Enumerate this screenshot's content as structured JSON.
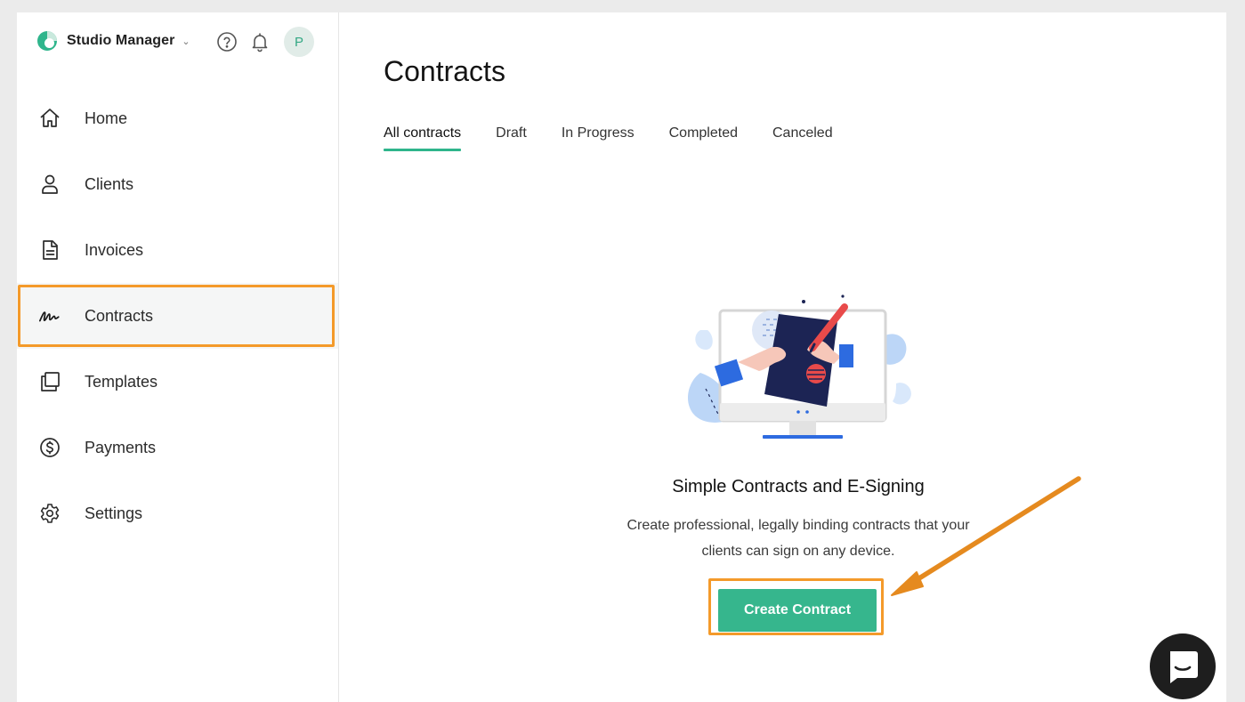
{
  "sidebar": {
    "brand": {
      "name": "Studio Manager",
      "chevron": "⌄",
      "logo_icon": "studio-logo-icon"
    },
    "top_icons": {
      "help": "help-circle-icon",
      "notifications": "bell-icon"
    },
    "avatar_initial": "P",
    "items": [
      {
        "label": "Home",
        "icon": "home-icon",
        "active": false
      },
      {
        "label": "Clients",
        "icon": "user-icon",
        "active": false
      },
      {
        "label": "Invoices",
        "icon": "document-icon",
        "active": false
      },
      {
        "label": "Contracts",
        "icon": "signature-icon",
        "active": true
      },
      {
        "label": "Templates",
        "icon": "copy-icon",
        "active": false
      },
      {
        "label": "Payments",
        "icon": "dollar-circle-icon",
        "active": false
      },
      {
        "label": "Settings",
        "icon": "gear-icon",
        "active": false
      }
    ]
  },
  "main": {
    "title": "Contracts",
    "tabs": [
      {
        "label": "All contracts",
        "active": true
      },
      {
        "label": "Draft",
        "active": false
      },
      {
        "label": "In Progress",
        "active": false
      },
      {
        "label": "Completed",
        "active": false
      },
      {
        "label": "Canceled",
        "active": false
      }
    ],
    "empty_state": {
      "title": "Simple Contracts and E-Signing",
      "description": "Create professional, legally binding contracts that your clients can sign on any device.",
      "cta_label": "Create Contract"
    }
  },
  "colors": {
    "accent": "#36b68d",
    "highlight": "#f49a2a",
    "avatar_bg": "#e1ece8"
  }
}
